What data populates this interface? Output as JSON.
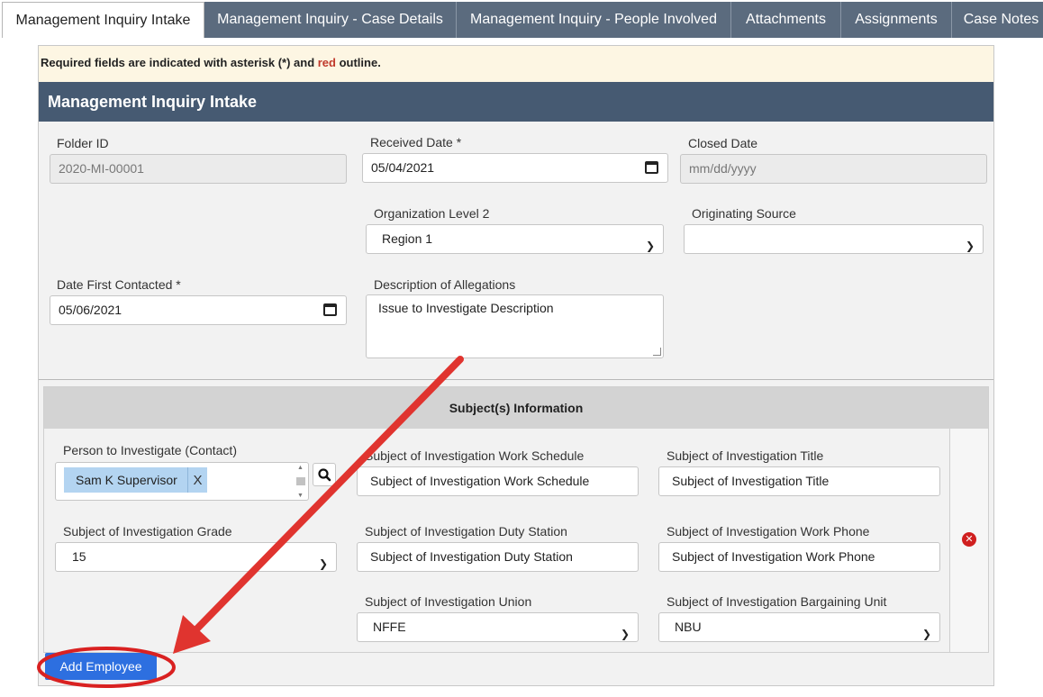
{
  "tabs": [
    {
      "label": "Management Inquiry Intake",
      "active": true
    },
    {
      "label": "Management Inquiry - Case Details",
      "active": false
    },
    {
      "label": "Management Inquiry - People Involved",
      "active": false
    },
    {
      "label": "Attachments",
      "active": false
    },
    {
      "label": "Assignments",
      "active": false
    },
    {
      "label": "Case Notes",
      "active": false
    }
  ],
  "notice": {
    "prefix": "Required fields are indicated with asterisk (*) and ",
    "red": "red",
    "suffix": " outline."
  },
  "section_title": "Management Inquiry Intake",
  "intake": {
    "folder_id": {
      "label": "Folder ID",
      "value": "2020-MI-00001"
    },
    "received_date": {
      "label": "Received Date *",
      "value": "05/04/2021"
    },
    "closed_date": {
      "label": "Closed Date",
      "placeholder": "mm/dd/yyyy"
    },
    "org_level_2": {
      "label": "Organization Level 2",
      "value": "Region 1"
    },
    "originating_source": {
      "label": "Originating Source",
      "value": ""
    },
    "date_first_contacted": {
      "label": "Date First Contacted *",
      "value": "05/06/2021"
    },
    "description": {
      "label": "Description of Allegations",
      "value": "Issue to Investigate Description"
    }
  },
  "subjects": {
    "title": "Subject(s) Information",
    "person": {
      "label": "Person to Investigate (Contact)",
      "tag": "Sam K Supervisor",
      "remove": "X"
    },
    "work_schedule": {
      "label": "Subject of Investigation Work Schedule",
      "value": "Subject of Investigation Work Schedule"
    },
    "title_field": {
      "label": "Subject of Investigation Title",
      "value": "Subject of Investigation Title"
    },
    "grade": {
      "label": "Subject of Investigation Grade",
      "value": "15"
    },
    "duty_station": {
      "label": "Subject of Investigation Duty Station",
      "value": "Subject of Investigation Duty Station"
    },
    "work_phone": {
      "label": "Subject of Investigation Work Phone",
      "value": "Subject of Investigation Work Phone"
    },
    "union": {
      "label": "Subject of Investigation Union",
      "value": "NFFE"
    },
    "bargaining_unit": {
      "label": "Subject of Investigation Bargaining Unit",
      "value": "NBU"
    }
  },
  "add_employee_label": "Add Employee",
  "colors": {
    "header": "#465a72",
    "tab": "#5b6b7e",
    "button": "#2d6fe0",
    "annotation": "#e0342f",
    "tag": "#b3d4f1"
  }
}
